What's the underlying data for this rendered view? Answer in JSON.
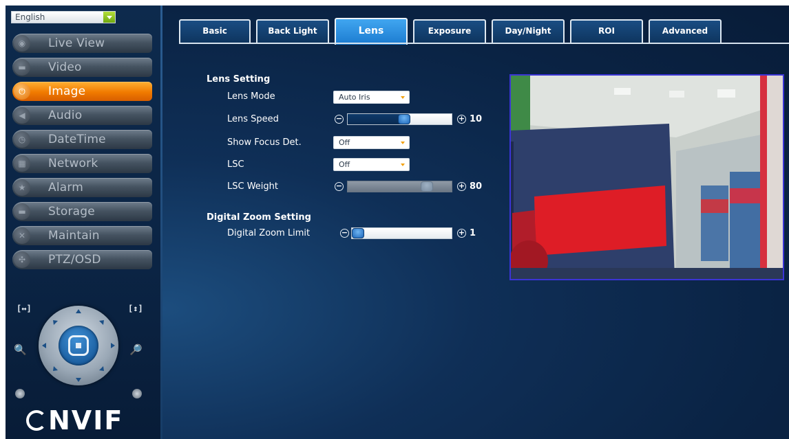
{
  "language": {
    "selected": "English"
  },
  "sidebar": {
    "items": [
      {
        "label": "Live View",
        "icon": "chat-bubble-icon"
      },
      {
        "label": "Video",
        "icon": "camera-icon"
      },
      {
        "label": "Image",
        "icon": "power-icon",
        "active": true
      },
      {
        "label": "Audio",
        "icon": "speaker-icon"
      },
      {
        "label": "DateTime",
        "icon": "clock-icon"
      },
      {
        "label": "Network",
        "icon": "network-icon"
      },
      {
        "label": "Alarm",
        "icon": "star-icon"
      },
      {
        "label": "Storage",
        "icon": "drive-icon"
      },
      {
        "label": "Maintain",
        "icon": "tools-icon"
      },
      {
        "label": "PTZ/OSD",
        "icon": "arrows-icon"
      }
    ]
  },
  "ptz": {
    "left_label": "[↔]",
    "right_label": "[↕]"
  },
  "brand": {
    "text": "NVIF"
  },
  "tabs": [
    {
      "label": "Basic"
    },
    {
      "label": "Back Light"
    },
    {
      "label": "Lens",
      "active": true
    },
    {
      "label": "Exposure"
    },
    {
      "label": "Day/Night"
    },
    {
      "label": "ROI"
    },
    {
      "label": "Advanced"
    }
  ],
  "lens": {
    "section_title": "Lens Setting",
    "mode": {
      "label": "Lens Mode",
      "value": "Auto Iris"
    },
    "speed": {
      "label": "Lens Speed",
      "value": "10",
      "position": 0.55
    },
    "focus": {
      "label": "Show Focus Det.",
      "value": "Off"
    },
    "lsc": {
      "label": "LSC",
      "value": "Off"
    },
    "lsc_weight": {
      "label": "LSC Weight",
      "value": "80",
      "position": 0.8,
      "disabled": true
    }
  },
  "zoom": {
    "section_title": "Digital Zoom Setting",
    "limit": {
      "label": "Digital Zoom Limit",
      "value": "1",
      "position": 0.0
    }
  },
  "colors": {
    "accent_active": "#f07a00",
    "tab_active": "#2b8fe0",
    "preview_border": "#3b34d6"
  }
}
